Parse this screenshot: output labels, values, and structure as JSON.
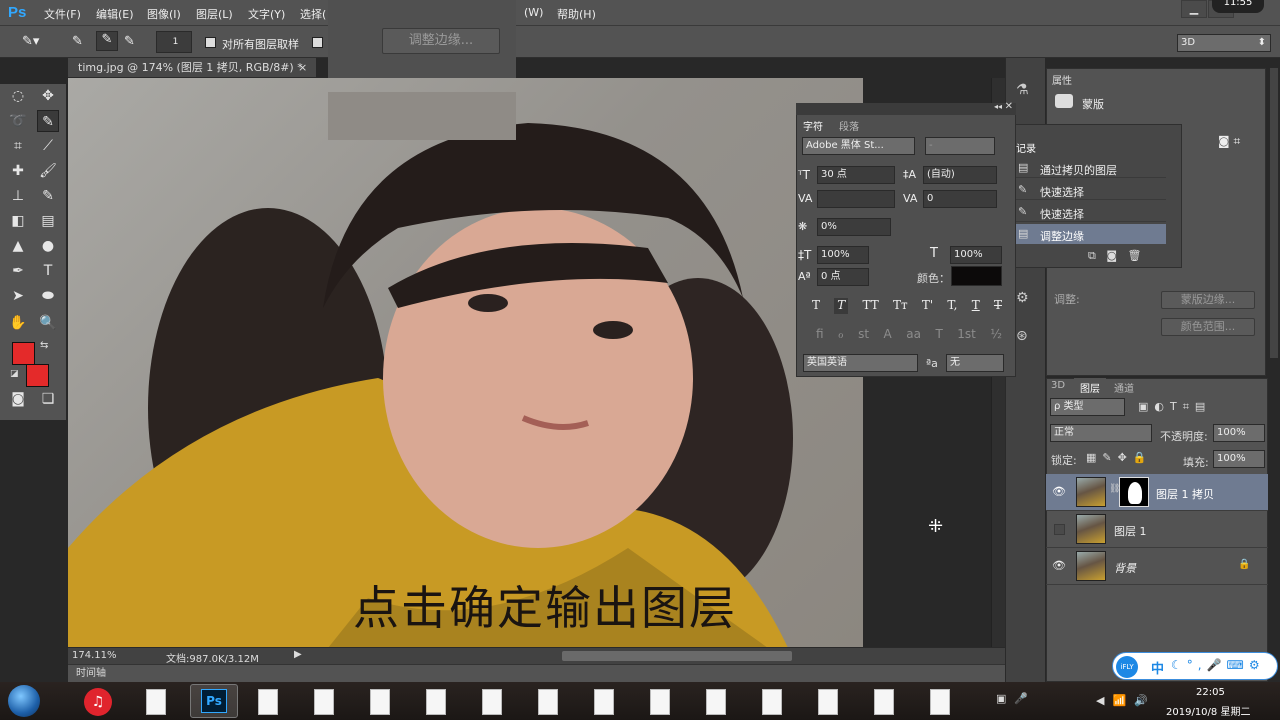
{
  "app": {
    "logo": "Ps"
  },
  "menu": [
    "文件(F)",
    "编辑(E)",
    "图像(I)",
    "图层(L)",
    "文字(Y)",
    "选择(",
    "(W)",
    "帮助(H)"
  ],
  "clock_top": "11:55",
  "options": {
    "brush_size": "1",
    "sample_all_layers": "对所有图层取样",
    "enhance_partial": "强",
    "refine_edge_button": "调整边缘...",
    "workspace": "3D"
  },
  "document": {
    "tab": "timg.jpg @ 174% (图层 1 拷贝, RGB/8#) *",
    "tab_close": "×"
  },
  "caption": "点击确定输出图层",
  "status": {
    "zoom": "174.11%",
    "doc": "文档:987.0K/3.12M"
  },
  "timeline_label": "时间轴",
  "character_panel": {
    "tabs": [
      "字符",
      "段落"
    ],
    "font_family": "Adobe 黑体 St...",
    "font_style": "-",
    "size": "30 点",
    "leading": "(自动)",
    "kerning": "",
    "tracking": "0",
    "scale_percent": "0%",
    "vscale": "100%",
    "hscale": "100%",
    "baseline": "0 点",
    "color_label": "颜色：",
    "style_buttons": [
      "T",
      "T",
      "TT",
      "Tт",
      "T'",
      "T,",
      "T",
      "T"
    ],
    "opentype_buttons": [
      "ﬁ",
      "ℴ",
      "st",
      "A",
      "aa",
      "T",
      "1st",
      "½"
    ],
    "language": "英国英语",
    "aa_label": "ªa",
    "aa_method": "无"
  },
  "history_panel": {
    "title": "记录",
    "items": [
      "通过拷贝的图层",
      "快速选择",
      "快速选择",
      "调整边缘"
    ]
  },
  "properties": {
    "title": "属性",
    "mask_label": "蒙版",
    "adjust_label": "调整:",
    "mask_edge_button": "蒙版边缘...",
    "color_range_button": "颜色范围..."
  },
  "layers_panel": {
    "tabs": [
      "3D",
      "图层",
      "通道"
    ],
    "filter": "ρ 类型",
    "blend_mode": "正常",
    "opacity_label": "不透明度:",
    "opacity": "100%",
    "lock_label": "锁定:",
    "fill_label": "填充:",
    "fill": "100%",
    "layers": [
      {
        "name": "图层 1 拷贝",
        "visible": true,
        "selected": true,
        "mask": true
      },
      {
        "name": "图层 1",
        "visible": false,
        "selected": false,
        "mask": false
      },
      {
        "name": "背景",
        "visible": true,
        "selected": false,
        "mask": false,
        "locked": true
      }
    ]
  },
  "ime": {
    "brand": "iFLY",
    "mode": "中"
  },
  "taskbar": {
    "time": "22:05",
    "date": "2019/10/8 星期二"
  },
  "colors": {
    "foreground": "#e42a2a",
    "background": "#e42a2a",
    "accent": "#31a8ff",
    "selected_layer": "#6f7b91"
  }
}
